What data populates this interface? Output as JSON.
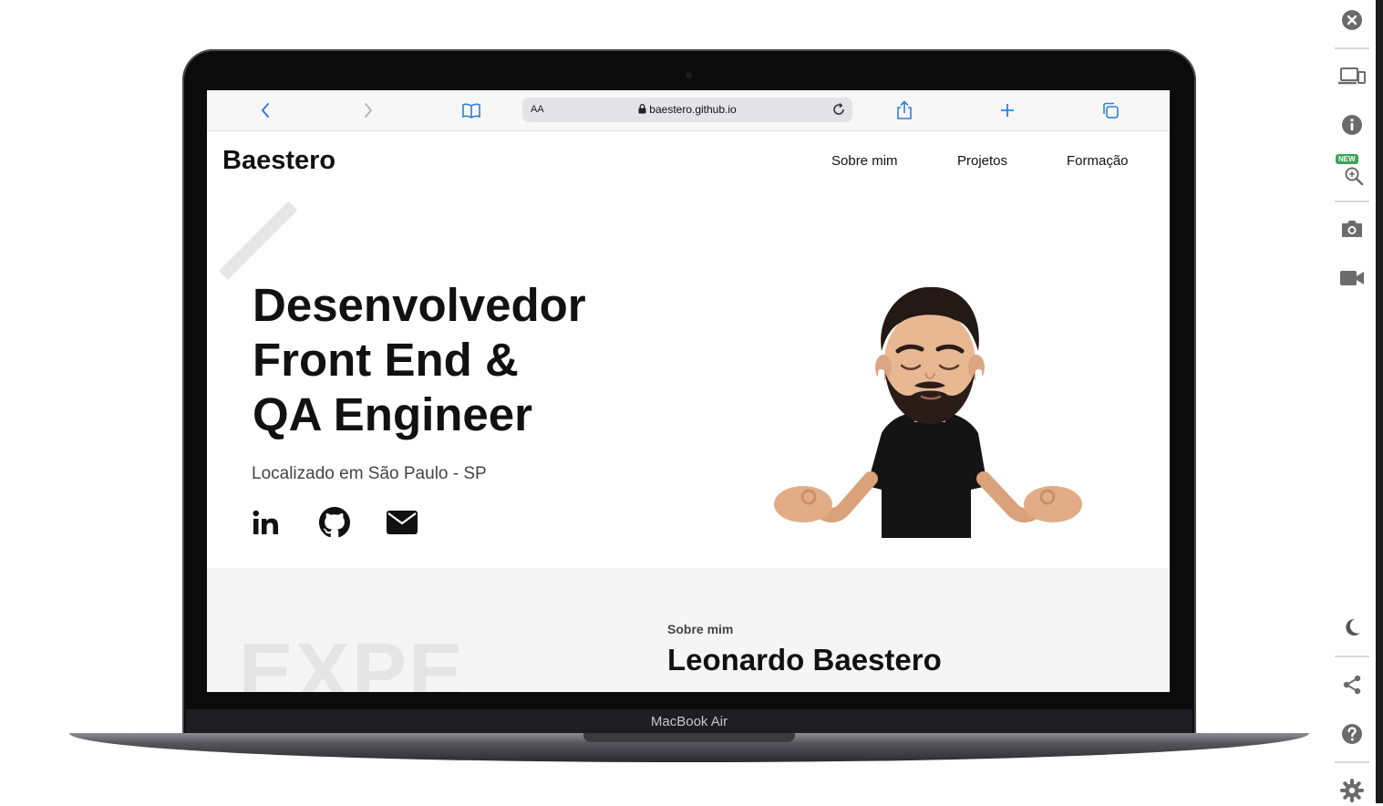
{
  "browser": {
    "text_size_label": "AA",
    "url": "baestero.github.io"
  },
  "site": {
    "logo": "Baestero",
    "nav": [
      "Sobre mim",
      "Projetos",
      "Formação"
    ],
    "hero": {
      "title_lines": [
        "Desenvolvedor",
        "Front End &",
        "QA Engineer"
      ],
      "location": "Localizado em São Paulo - SP",
      "social_icons": [
        "linkedin-icon",
        "github-icon",
        "email-icon"
      ]
    },
    "about": {
      "watermark": "EXPE",
      "kicker": "Sobre mim",
      "name": "Leonardo Baestero"
    }
  },
  "device": {
    "label": "MacBook Air"
  },
  "toolbar": {
    "new_badge": "NEW",
    "icons": [
      "close-icon",
      "devices-icon",
      "info-icon",
      "zoom-in-icon",
      "camera-icon",
      "video-icon",
      "moon-icon",
      "share-icon",
      "help-icon",
      "settings-icon"
    ]
  },
  "colors": {
    "accent_blue": "#2f7fd8",
    "rail_icon": "#6b6b6b",
    "new_badge": "#3aa356"
  }
}
